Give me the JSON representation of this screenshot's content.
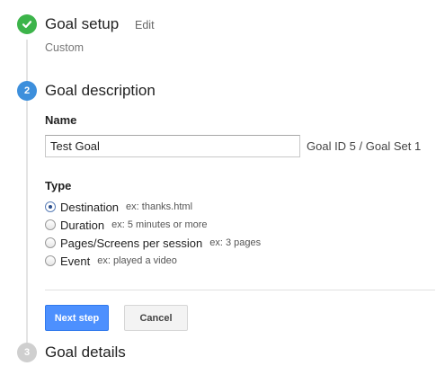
{
  "steps": {
    "setup": {
      "title": "Goal setup",
      "edit_label": "Edit",
      "summary": "Custom",
      "status_icon": "checkmark-icon"
    },
    "description": {
      "number": "2",
      "title": "Goal description"
    },
    "details": {
      "number": "3",
      "title": "Goal details"
    }
  },
  "form": {
    "name_label": "Name",
    "name_value": "Test Goal",
    "goal_id": "Goal ID 5 / Goal Set 1",
    "type_label": "Type",
    "types": [
      {
        "label": "Destination",
        "example": "ex: thanks.html",
        "selected": true
      },
      {
        "label": "Duration",
        "example": "ex: 5 minutes or more",
        "selected": false
      },
      {
        "label": "Pages/Screens per session",
        "example": "ex: 3 pages",
        "selected": false
      },
      {
        "label": "Event",
        "example": "ex: played a video",
        "selected": false
      }
    ]
  },
  "buttons": {
    "next": "Next step",
    "cancel": "Cancel"
  },
  "colors": {
    "done": "#3cb44a",
    "active": "#3d8fdc",
    "pending": "#cfcfcf",
    "primary": "#4d90fe"
  }
}
